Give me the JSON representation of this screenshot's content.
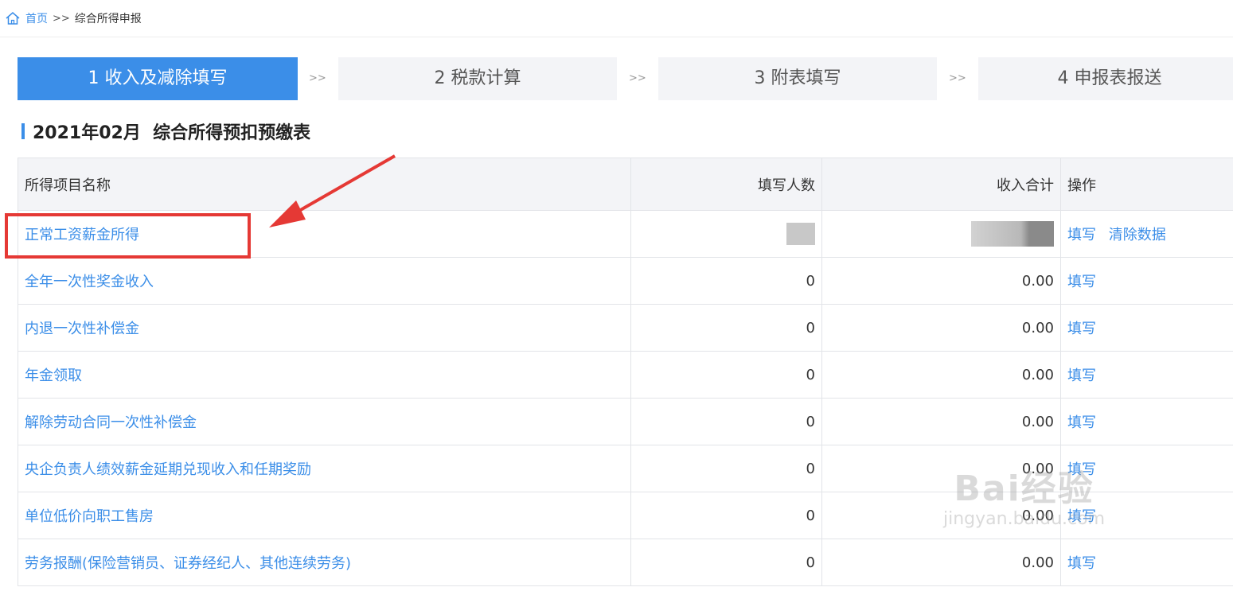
{
  "breadcrumb": {
    "home": "首页",
    "separator": ">>",
    "current": "综合所得申报"
  },
  "steps": [
    {
      "label": "1 收入及减除填写",
      "active": true
    },
    {
      "label": "2 税款计算",
      "active": false
    },
    {
      "label": "3 附表填写",
      "active": false
    },
    {
      "label": "4 申报表报送",
      "active": false
    }
  ],
  "step_arrow": ">>",
  "section_title": "2021年02月  综合所得预扣预缴表",
  "table": {
    "headers": {
      "name": "所得项目名称",
      "count": "填写人数",
      "amount": "收入合计",
      "action": "操作"
    },
    "rows": [
      {
        "name": "正常工资薪金所得",
        "count": "",
        "amount": "",
        "actions": [
          "填写",
          "清除数据"
        ],
        "redacted": true
      },
      {
        "name": "全年一次性奖金收入",
        "count": "0",
        "amount": "0.00",
        "actions": [
          "填写"
        ]
      },
      {
        "name": "内退一次性补偿金",
        "count": "0",
        "amount": "0.00",
        "actions": [
          "填写"
        ]
      },
      {
        "name": "年金领取",
        "count": "0",
        "amount": "0.00",
        "actions": [
          "填写"
        ]
      },
      {
        "name": "解除劳动合同一次性补偿金",
        "count": "0",
        "amount": "0.00",
        "actions": [
          "填写"
        ]
      },
      {
        "name": "央企负责人绩效薪金延期兑现收入和任期奖励",
        "count": "0",
        "amount": "0.00",
        "actions": [
          "填写"
        ]
      },
      {
        "name": "单位低价向职工售房",
        "count": "0",
        "amount": "0.00",
        "actions": [
          "填写"
        ]
      },
      {
        "name": "劳务报酬(保险营销员、证券经纪人、其他连续劳务)",
        "count": "0",
        "amount": "0.00",
        "actions": [
          "填写"
        ]
      }
    ]
  },
  "watermark": {
    "main": "Bai经验",
    "sub": "jingyan.baidu.com"
  },
  "colors": {
    "accent": "#3b8ee8",
    "annotation": "#e53935",
    "step_inactive_bg": "#f3f4f7"
  }
}
